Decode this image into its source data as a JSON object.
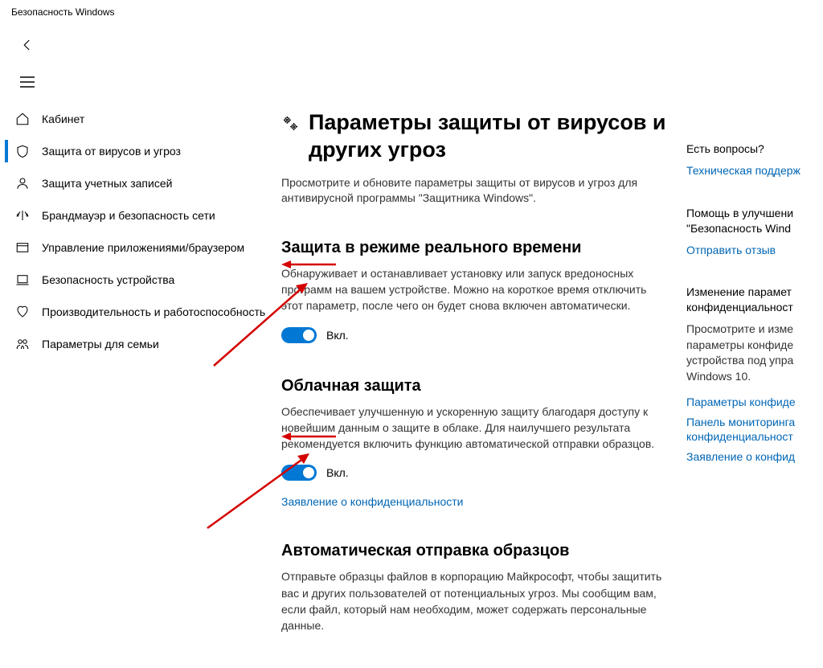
{
  "window_title": "Безопасность Windows",
  "sidebar": {
    "items": [
      {
        "label": "Кабинет",
        "icon": "home"
      },
      {
        "label": "Защита от вирусов и угроз",
        "icon": "shield",
        "active": true
      },
      {
        "label": "Защита учетных записей",
        "icon": "person"
      },
      {
        "label": "Брандмауэр и безопасность сети",
        "icon": "signal"
      },
      {
        "label": "Управление приложениями/браузером",
        "icon": "window"
      },
      {
        "label": "Безопасность устройства",
        "icon": "device"
      },
      {
        "label": "Производительность и работоспособность",
        "icon": "heart"
      },
      {
        "label": "Параметры для семьи",
        "icon": "family"
      }
    ]
  },
  "page": {
    "title": "Параметры защиты от вирусов и других угроз",
    "description": "Просмотрите и обновите параметры защиты от вирусов и угроз для антивирусной программы \"Защитника Windows\"."
  },
  "sections": [
    {
      "title": "Защита в режиме реального времени",
      "desc": "Обнаруживает и останавливает установку или запуск вредоносных программ на вашем устройстве. Можно на короткое время отключить этот параметр, после чего он будет снова включен автоматически.",
      "toggle_state": "Вкл."
    },
    {
      "title": "Облачная защита",
      "desc": "Обеспечивает улучшенную и ускоренную защиту благодаря доступу к новейшим данным о защите в облаке. Для наилучшего результата рекомендуется включить функцию автоматической отправки образцов.",
      "toggle_state": "Вкл.",
      "link": "Заявление о конфиденциальности"
    },
    {
      "title": "Автоматическая отправка образцов",
      "desc": "Отправьте образцы файлов в корпорацию Майкрософт, чтобы защитить вас и других пользователей от потенциальных угроз. Мы сообщим вам, если файл, который нам необходим, может содержать персональные данные."
    }
  ],
  "right": {
    "questions_title": "Есть вопросы?",
    "questions_link": "Техническая поддерж",
    "feedback_title": "Помощь в улучшени \"Безопасность Wind",
    "feedback_link": "Отправить отзыв",
    "privacy_title": "Изменение парамет конфиденциальност",
    "privacy_text": "Просмотрите и изме параметры конфиде устройства под упра Windows 10.",
    "privacy_links": [
      "Параметры конфиде",
      "Панель мониторинга конфиденциальност",
      "Заявление о конфид"
    ]
  }
}
